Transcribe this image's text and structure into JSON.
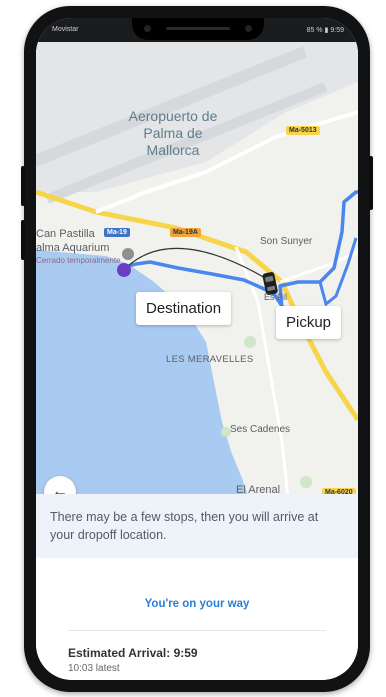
{
  "status_bar": {
    "carrier": "Movistar",
    "battery": "85 %",
    "time": "9:59"
  },
  "map": {
    "labels": {
      "airport": "Aeropuerto de Palma de Mallorca",
      "can_pastilla": "Can Pastilla",
      "aquarium": "alma Aquarium",
      "aquarium_note": "Cerrado temporalmente",
      "son_sunyer": "Son Sunyer",
      "es_pil": "Es Pil",
      "les_meravelles": "LES MERAVELLES",
      "ses_cadenes": "Ses Cadenes",
      "el_arenal": "El Arenal"
    },
    "roads": {
      "ma5013": "Ma-5013",
      "ma19": "Ma-19",
      "ma19a": "Ma-19A",
      "ma6020": "Ma-6020"
    },
    "destination_label": "Destination",
    "pickup_label": "Pickup",
    "colors": {
      "water": "#a9cbf2",
      "route": "#4a86f0",
      "destination_pin": "#6b3fc4",
      "badge_blue": "#3d72c7",
      "badge_orange": "#f0a43a",
      "badge_yellow": "#f7d54a"
    }
  },
  "sheet": {
    "message": "There may be a few stops, then you will arrive at your dropoff location.",
    "status": "You're on your way",
    "eta": "Estimated Arrival: 9:59",
    "latest": "10:03 latest"
  }
}
